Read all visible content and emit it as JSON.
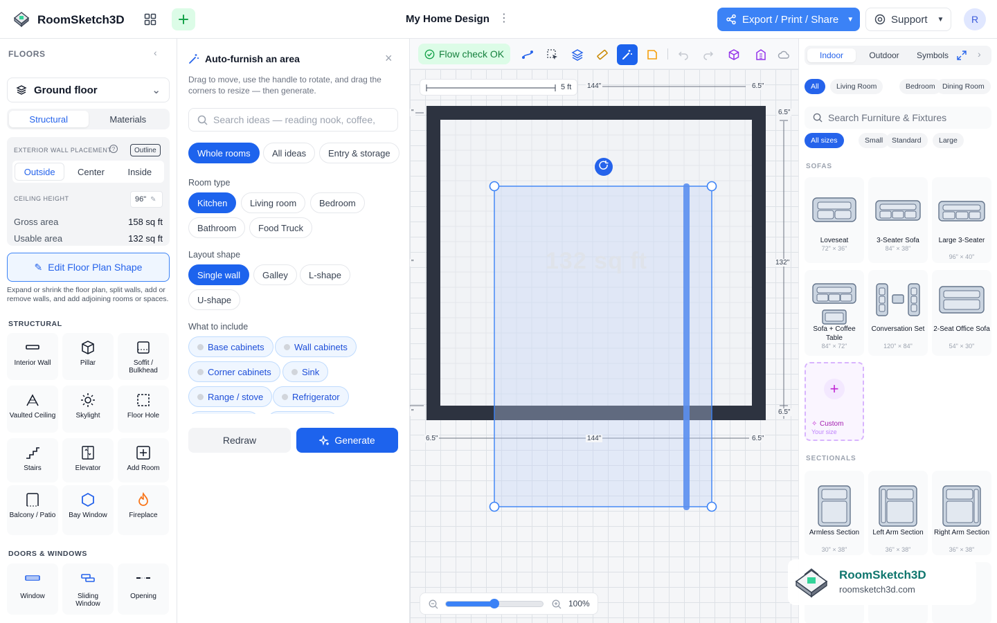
{
  "app": {
    "name": "RoomSketch3D",
    "doc_title": "My Home Design",
    "export_label": "Export / Print / Share",
    "support_label": "Support",
    "avatar_initial": "R"
  },
  "colors": {
    "accent": "#1d63ed",
    "wall": "#2d3340",
    "success": "#15803d",
    "custom": "#c026d3"
  },
  "left": {
    "header": "FLOORS",
    "floor": "Ground floor",
    "tabs": [
      "Structural",
      "Materials"
    ],
    "wall_placement_label": "EXTERIOR WALL PLACEMENT",
    "outline_badge": "Outline",
    "placement_options": [
      "Outside",
      "Center",
      "Inside"
    ],
    "ceiling_label": "CEILING HEIGHT",
    "ceiling_value": "96\"",
    "gross_label": "Gross area",
    "gross_value": "158 sq ft",
    "usable_label": "Usable area",
    "usable_value": "132 sq ft",
    "edit_shape": "Edit Floor Plan Shape",
    "edit_desc": "Expand or shrink the floor plan, split walls, add or remove walls, and add adjoining rooms or spaces.",
    "structural_title": "STRUCTURAL",
    "structural": [
      "Interior Wall",
      "Pillar",
      "Soffit / Bulkhead",
      "Vaulted Ceiling",
      "Skylight",
      "Floor Hole",
      "Stairs",
      "Elevator",
      "Add Room",
      "Balcony / Patio",
      "Bay Window",
      "Fireplace"
    ],
    "doors_title": "DOORS & WINDOWS",
    "doors": [
      "Window",
      "Sliding Window",
      "Opening"
    ]
  },
  "autofurnish": {
    "title": "Auto-furnish an area",
    "desc": "Drag to move, use the handle to rotate, and drag the corners to resize — then generate.",
    "search_placeholder": "Search ideas — reading nook, coffee,",
    "filters": [
      "Whole rooms",
      "All ideas",
      "Entry & storage"
    ],
    "room_type_label": "Room type",
    "room_types": [
      "Kitchen",
      "Living room",
      "Bedroom",
      "Bathroom",
      "Food Truck"
    ],
    "layout_label": "Layout shape",
    "layouts": [
      "Single wall",
      "Galley",
      "L-shape",
      "U-shape"
    ],
    "include_label": "What to include",
    "includes": [
      "Base cabinets",
      "Wall cabinets",
      "Corner cabinets",
      "Sink",
      "Range / stove",
      "Refrigerator"
    ],
    "redraw": "Redraw",
    "generate": "Generate"
  },
  "canvas": {
    "flow_check": "Flow check OK",
    "scale_label": "5 ft",
    "dim_width": "144\"",
    "dim_wall": "6.5\"",
    "dim_height": "132\"",
    "area_label": "132 sq ft",
    "edge_quote": "\"",
    "zoom_percent": "100%",
    "zoom_level": 0.5
  },
  "right": {
    "tabs": [
      "Indoor",
      "Outdoor",
      "Symbols"
    ],
    "categories": [
      "All",
      "Living Room",
      "Bedroom",
      "Dining Room"
    ],
    "search_placeholder": "Search Furniture & Fixtures",
    "sizes": [
      "All sizes",
      "Small",
      "Standard",
      "Large"
    ],
    "sofas_title": "SOFAS",
    "sofas": [
      {
        "name": "Loveseat",
        "size": "72\" × 36\""
      },
      {
        "name": "3-Seater Sofa",
        "size": "84\" × 38\""
      },
      {
        "name": "Large 3-Seater",
        "size": "96\" × 40\""
      },
      {
        "name": "Sofa + Coffee Table",
        "size": "84\" × 72\""
      },
      {
        "name": "Conversation Set",
        "size": "120\" × 84\""
      },
      {
        "name": "2-Seat Office Sofa",
        "size": "54\" × 30\""
      }
    ],
    "custom_label": "Custom",
    "custom_sub": "Your size",
    "sectionals_title": "SECTIONALS",
    "sectionals": [
      {
        "name": "Armless Section",
        "size": "30\" × 38\""
      },
      {
        "name": "Left Arm Section",
        "size": "36\" × 38\""
      },
      {
        "name": "Right Arm Section",
        "size": "36\" × 38\""
      }
    ]
  },
  "watermark": {
    "name": "RoomSketch3D",
    "url": "roomsketch3d.com"
  }
}
